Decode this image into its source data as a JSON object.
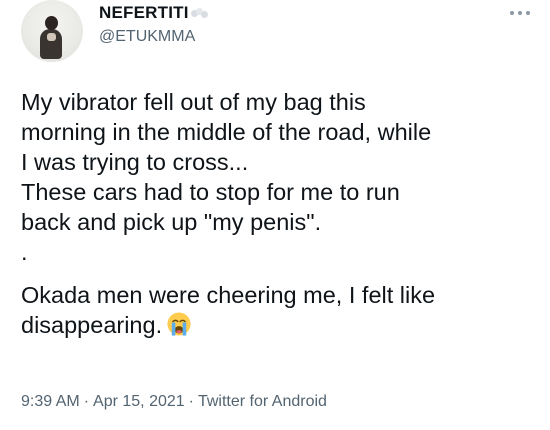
{
  "author": {
    "display_name": "NEFERTITI",
    "name_emoji": "cloud-emoji",
    "username": "@ETUKMMA",
    "avatar_icon": "profile-photo"
  },
  "menu": {
    "icon": "more-icon"
  },
  "tweet": {
    "lines": [
      "My vibrator fell out of my bag this",
      "morning in the middle of the road, while",
      "I was trying to cross...",
      "These cars had to stop for me to run",
      "back and pick up \"my penis\".",
      ".",
      "Okada men were cheering me, I felt like",
      "disappearing."
    ],
    "end_emoji": "loudly-crying-face-emoji"
  },
  "meta": {
    "time": "9:39 AM",
    "separator": "·",
    "date": "Apr 15, 2021",
    "source": "Twitter for Android"
  },
  "colors": {
    "text_primary": "#0f1419",
    "text_secondary": "#536471",
    "background": "#ffffff"
  }
}
